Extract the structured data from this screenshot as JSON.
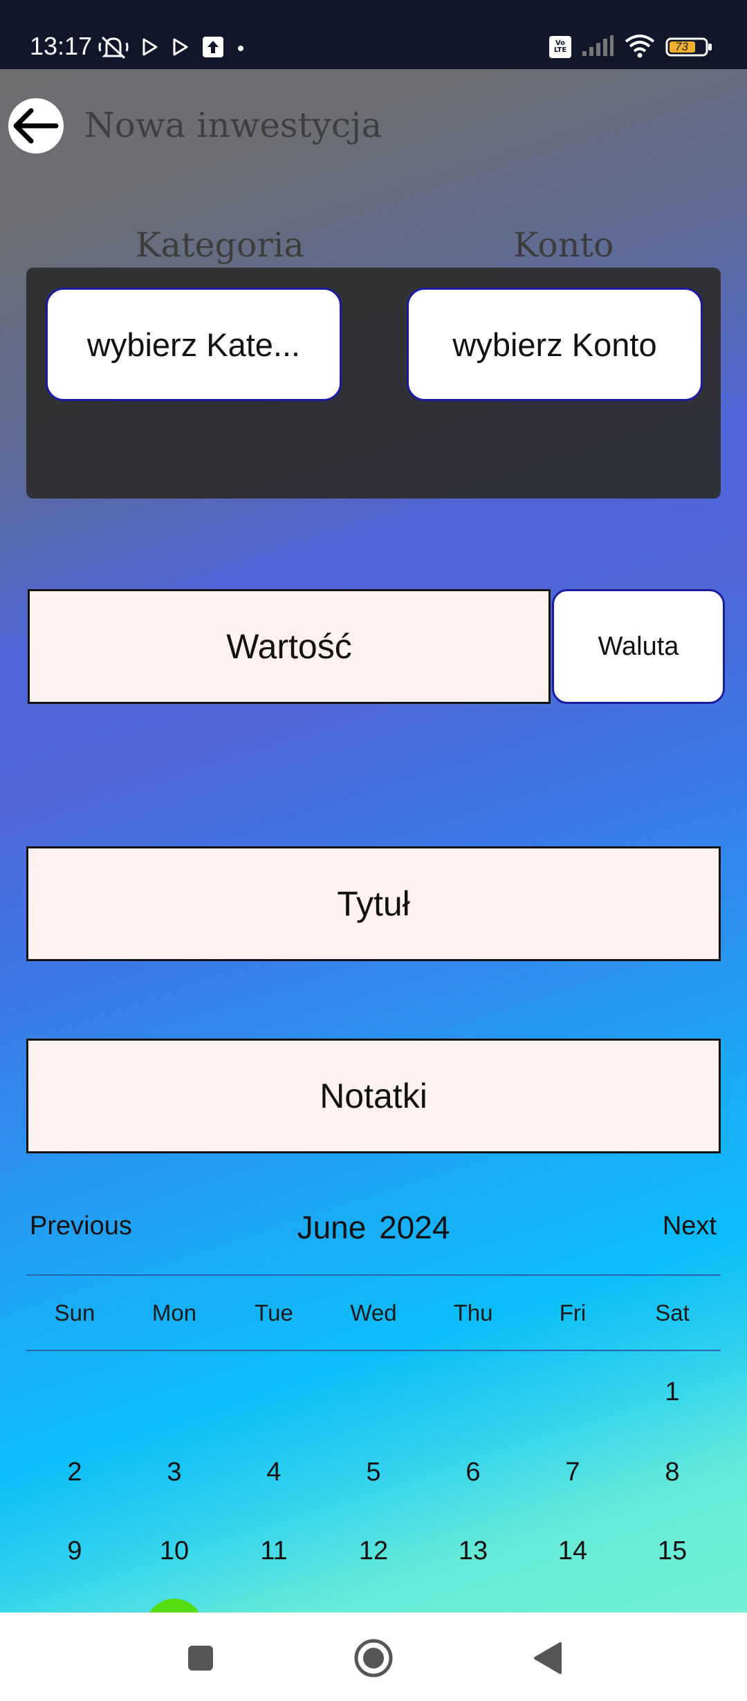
{
  "status_bar": {
    "time": "13:17",
    "battery_level": "73",
    "network_badge": "Vo LTE",
    "icons_left": [
      "mute-icon",
      "play-store-icon",
      "play-store-icon",
      "upload-icon",
      "dot-icon"
    ],
    "icons_right": [
      "volte-icon",
      "signal-icon",
      "wifi-icon",
      "battery-icon"
    ]
  },
  "header": {
    "title": "Nowa inwestycja",
    "back_icon": "arrow-left-icon"
  },
  "selectors": {
    "category_label": "Kategoria",
    "account_label": "Konto",
    "category_button": "wybierz Kate...",
    "account_button": "wybierz Konto"
  },
  "form": {
    "value_placeholder": "Wartość",
    "currency_button": "Waluta",
    "title_placeholder": "Tytuł",
    "notes_placeholder": "Notatki"
  },
  "calendar": {
    "previous": "Previous",
    "month": "June",
    "year": "2024",
    "next": "Next",
    "weekdays": [
      "Sun",
      "Mon",
      "Tue",
      "Wed",
      "Thu",
      "Fri",
      "Sat"
    ],
    "days": [
      "1",
      "2",
      "3",
      "4",
      "5",
      "6",
      "7",
      "8",
      "9",
      "10",
      "11",
      "12",
      "13",
      "14",
      "15"
    ],
    "selected_color": "#55dd11"
  },
  "nav_bar": {
    "recents_icon": "square-icon",
    "home_icon": "circle-icon",
    "back_icon": "triangle-back-icon"
  },
  "colors": {
    "status_bar_bg": "#11162a",
    "field_bg": "#fdf2ef",
    "button_border": "#1a1aa0"
  }
}
